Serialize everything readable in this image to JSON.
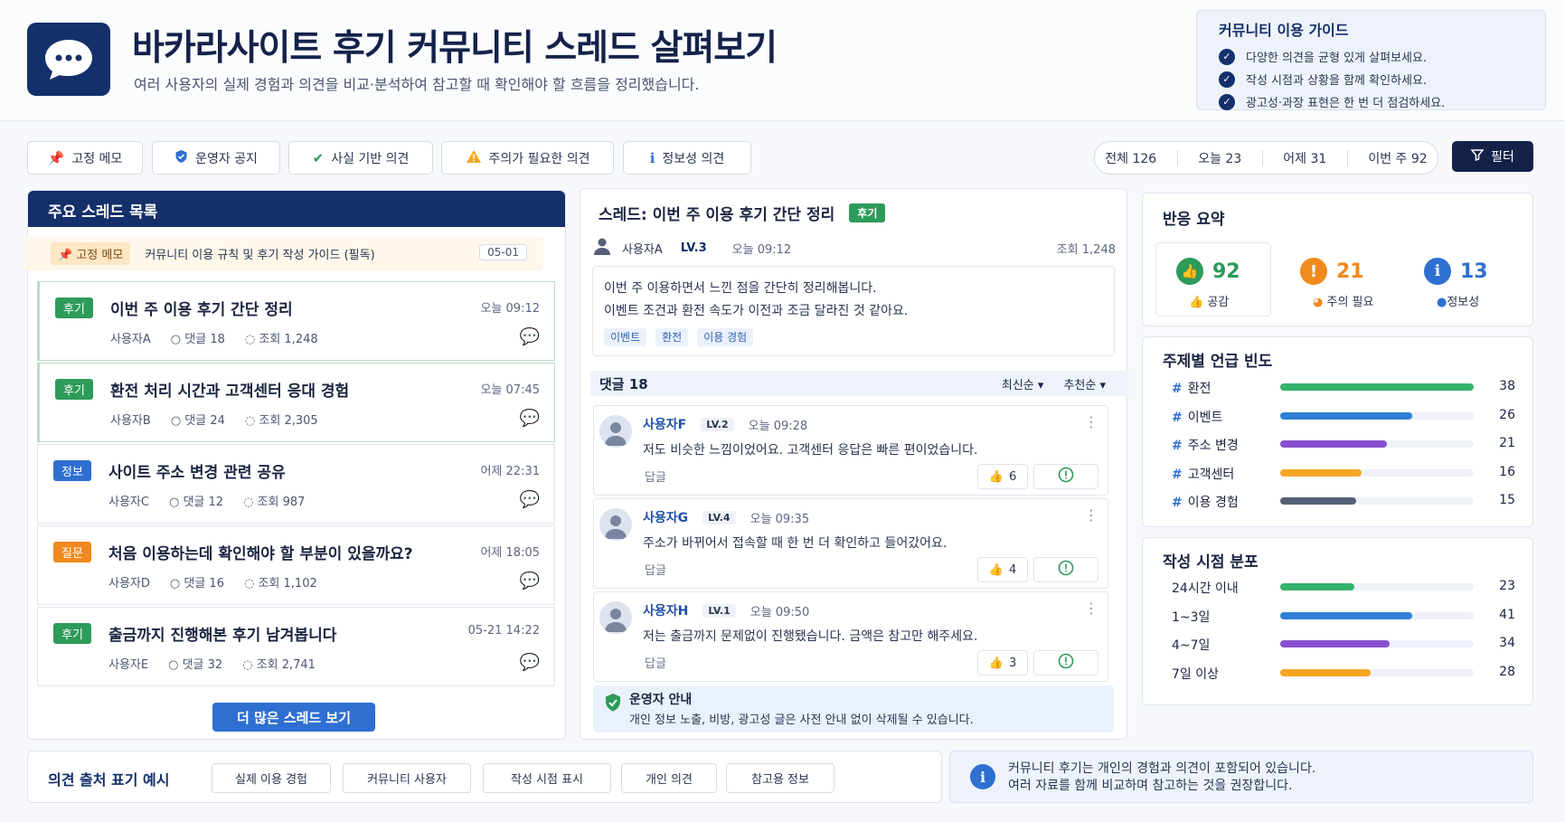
{
  "header": {
    "title": "바카라사이트 후기 커뮤니티 스레드 살펴보기",
    "subtitle": "여러 사용자의 실제 경험과 의견을 비교·분석하여 참고할 때 확인해야 할 흐름을 정리했습니다."
  },
  "guide": {
    "title": "커뮤니티 이용 가이드",
    "items": [
      "다양한 의견을 균형 있게 살펴보세요.",
      "작성 시점과 상황을 함께 확인하세요.",
      "광고성·과장 표현은 한 번 더 점검하세요."
    ]
  },
  "filters": [
    "고정 메모",
    "운영자 공지",
    "사실 기반 의견",
    "주의가 필요한 의견",
    "정보성 의견"
  ],
  "stats": [
    "전체 126",
    "오늘 23",
    "어제 31",
    "이번 주 92"
  ],
  "filter_button": "필터",
  "thread_list": {
    "title": "주요 스레드 목록",
    "pinned": {
      "badge": "고정 메모",
      "text": "커뮤니티 이용 규칙 및 후기 작성 가이드 (필독)",
      "date": "05-01"
    },
    "threads": [
      {
        "badge": "후기",
        "title": "이번 주 이용 후기 간단 정리",
        "time": "오늘 09:12",
        "author": "사용자A",
        "comments": "댓글 18",
        "views": "조회 1,248"
      },
      {
        "badge": "후기",
        "title": "환전 처리 시간과 고객센터 응대 경험",
        "time": "오늘 07:45",
        "author": "사용자B",
        "comments": "댓글 24",
        "views": "조회 2,305"
      },
      {
        "badge": "정보",
        "title": "사이트 주소 변경 관련 공유",
        "time": "어제 22:31",
        "author": "사용자C",
        "comments": "댓글 12",
        "views": "조회 987"
      },
      {
        "badge": "질문",
        "title": "처음 이용하는데 확인해야 할 부분이 있을까요?",
        "time": "어제 18:05",
        "author": "사용자D",
        "comments": "댓글 16",
        "views": "조회 1,102"
      },
      {
        "badge": "후기",
        "title": "출금까지 진행해본 후기 남겨봅니다",
        "time": "05-21 14:22",
        "author": "사용자E",
        "comments": "댓글 32",
        "views": "조회 2,741"
      }
    ],
    "more_button": "더 많은 스레드 보기"
  },
  "thread_detail": {
    "title": "스레드: 이번 주 이용 후기 간단 정리",
    "badge": "후기",
    "author": "사용자A",
    "level": "LV.3",
    "time": "오늘 09:12",
    "views": "조회 1,248",
    "body_line1": "이번 주 이용하면서 느낀 점을 간단히 정리해봅니다.",
    "body_line2": "이벤트 조건과 환전 속도가 이전과 조금 달라진 것 같아요.",
    "tags": [
      "이벤트",
      "환전",
      "이용 경험"
    ]
  },
  "comments": {
    "title": "댓글 18",
    "sort1": "최신순",
    "sort2": "추천순",
    "items": [
      {
        "author": "사용자F",
        "level": "LV.2",
        "time": "오늘 09:28",
        "body": "저도 비슷한 느낌이었어요. 고객센터 응답은 빠른 편이었습니다.",
        "reply": "답글",
        "likes": "6"
      },
      {
        "author": "사용자G",
        "level": "LV.4",
        "time": "오늘 09:35",
        "body": "주소가 바뀌어서 접속할 때 한 번 더 확인하고 들어갔어요.",
        "reply": "답글",
        "likes": "4"
      },
      {
        "author": "사용자H",
        "level": "LV.1",
        "time": "오늘 09:50",
        "body": "저는 출금까지 문제없이 진행됐습니다. 금액은 참고만 해주세요.",
        "reply": "답글",
        "likes": "3"
      }
    ],
    "operator": {
      "title": "운영자 안내",
      "text": "개인 정보 노출, 비방, 광고성 글은 사전 안내 없이 삭제될 수 있습니다."
    }
  },
  "reactions": {
    "title": "반응 요약",
    "items": [
      {
        "value": "92",
        "label": "공감",
        "color": "#2d9b5a"
      },
      {
        "value": "21",
        "label": "주의 필요",
        "color": "#f08a1c"
      },
      {
        "value": "13",
        "label": "정보성",
        "color": "#2f6fd1"
      }
    ]
  },
  "topics": {
    "title": "주제별 언급 빈도",
    "items": [
      {
        "label": "환전",
        "value": 38,
        "color": "#34b36a"
      },
      {
        "label": "이벤트",
        "value": 26,
        "color": "#2f7fd6"
      },
      {
        "label": "주소 변경",
        "value": 21,
        "color": "#8a4fd0"
      },
      {
        "label": "고객센터",
        "value": 16,
        "color": "#f5a623"
      },
      {
        "label": "이용 경험",
        "value": 15,
        "color": "#566178"
      }
    ]
  },
  "timing": {
    "title": "작성 시점 분포",
    "items": [
      {
        "label": "24시간 이내",
        "value": 23,
        "color": "#34b36a"
      },
      {
        "label": "1~3일",
        "value": 41,
        "color": "#2f7fd6"
      },
      {
        "label": "4~7일",
        "value": 34,
        "color": "#8a4fd0"
      },
      {
        "label": "7일 이상",
        "value": 28,
        "color": "#f5a623"
      }
    ]
  },
  "source_examples": {
    "title": "의견 출처 표기 예시",
    "items": [
      "실제 이용 경험",
      "커뮤니티 사용자",
      "작성 시점 표시",
      "개인 의견",
      "참고용 정보"
    ]
  },
  "notice": {
    "line1": "커뮤니티 후기는 개인의 경험과 의견이 포함되어 있습니다.",
    "line2": "여러 자료를 함께 비교하며 참고하는 것을 권장합니다."
  }
}
